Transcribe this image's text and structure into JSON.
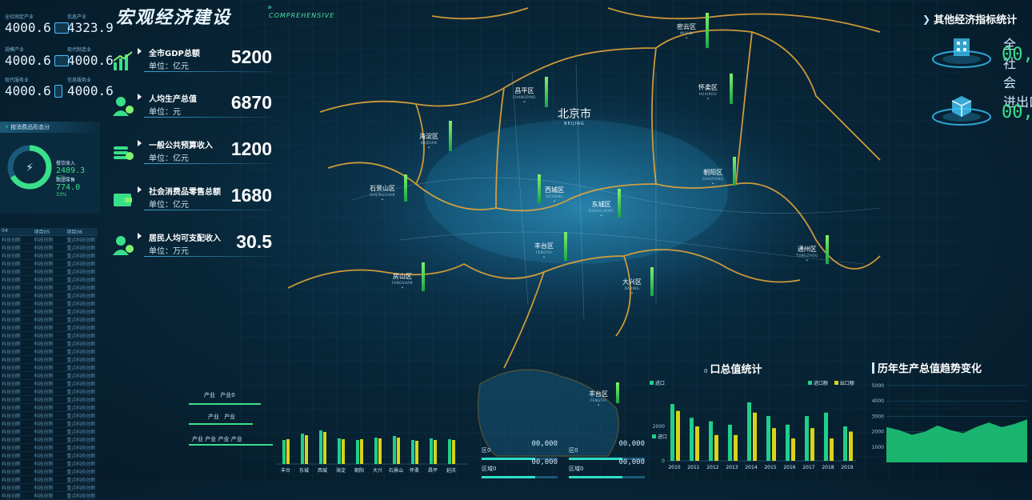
{
  "header": {
    "title": "宏观经济建设",
    "subtitle": "COMPREHENSIVE"
  },
  "top_tiles": [
    {
      "label": "全社固定产业",
      "value": "4000.6",
      "icon": "building-icon"
    },
    {
      "label": "信息产业",
      "value": "4323.9",
      "icon": "truck-icon"
    },
    {
      "label": "规模产业",
      "value": "4000.6",
      "icon": "car-icon"
    },
    {
      "label": "现代制造业",
      "value": "4000.6",
      "icon": "car-icon"
    },
    {
      "label": "现代服务业",
      "value": "4000.6",
      "icon": "phone-icon"
    },
    {
      "label": "信息服务业",
      "value": "4000.6",
      "icon": "phone-icon"
    }
  ],
  "consumption": {
    "title": "按消费品形态分",
    "items": [
      {
        "label": "餐饮收入",
        "pct": "67%",
        "value": "2489.3"
      },
      {
        "label": "商品零售",
        "pct": "33%",
        "value": "774.0"
      }
    ],
    "share": 0.67
  },
  "left_table": {
    "headers": [
      "04",
      "项目05",
      "项目06"
    ],
    "rows": [
      [
        "科技创新",
        "科技创新",
        "重点科技创新"
      ],
      [
        "科技创新",
        "科技创新",
        "重点科技创新"
      ],
      [
        "科技创新",
        "科技创新",
        "重点科技创新"
      ],
      [
        "科技创新",
        "科技创新",
        "重点科技创新"
      ],
      [
        "科技创新",
        "科技创新",
        "重点科技创新"
      ],
      [
        "科技创新",
        "科技创新",
        "重点科技创新"
      ],
      [
        "科技创新",
        "科技创新",
        "重点科技创新"
      ],
      [
        "科技创新",
        "科技创新",
        "重点科技创新"
      ],
      [
        "科技创新",
        "科技创新",
        "重点科技创新"
      ],
      [
        "科技创新",
        "科技创新",
        "重点科技创新"
      ],
      [
        "科技创新",
        "科技创新",
        "重点科技创新"
      ],
      [
        "科技创新",
        "科技创新",
        "重点科技创新"
      ],
      [
        "科技创新",
        "科技创新",
        "重点科技创新"
      ],
      [
        "科技创新",
        "科技创新",
        "重点科技创新"
      ],
      [
        "科技创新",
        "科技创新",
        "重点科技创新"
      ],
      [
        "科技创新",
        "科技创新",
        "重点科技创新"
      ],
      [
        "科技创新",
        "科技创新",
        "重点科技创新"
      ],
      [
        "科技创新",
        "科技创新",
        "重点科技创新"
      ],
      [
        "科技创新",
        "科技创新",
        "重点科技创新"
      ],
      [
        "科技创新",
        "科技创新",
        "重点科技创新"
      ],
      [
        "科技创新",
        "科技创新",
        "重点科技创新"
      ],
      [
        "科技创新",
        "科技创新",
        "重点科技创新"
      ],
      [
        "科技创新",
        "科技创新",
        "重点科技创新"
      ],
      [
        "科技创新",
        "科技创新",
        "重点科技创新"
      ],
      [
        "科技创新",
        "科技创新",
        "重点科技创新"
      ],
      [
        "科技创新",
        "科技创新",
        "重点科技创新"
      ],
      [
        "科技创新",
        "科技创新",
        "重点科技创新"
      ],
      [
        "科技创新",
        "科技创新",
        "重点科技创新"
      ],
      [
        "科技创新",
        "科技创新",
        "重点科技创新"
      ],
      [
        "科技创新",
        "科技创新",
        "重点科技创新"
      ],
      [
        "科技创新",
        "科技创新",
        "重点科技创新"
      ],
      [
        "科技创新",
        "科技创新",
        "重点科技创新"
      ],
      [
        "科技创新",
        "科技创新",
        "重点科技创新"
      ]
    ]
  },
  "kpis": [
    {
      "name": "全市GDP总额",
      "unit": "单位：亿元",
      "value": "5200",
      "icon": "chart-up-icon"
    },
    {
      "name": "人均生产总值",
      "unit": "单位：元",
      "value": "6870",
      "icon": "user-money-icon"
    },
    {
      "name": "一般公共预算收入",
      "unit": "单位：亿元",
      "value": "1200",
      "icon": "coins-icon"
    },
    {
      "name": "社会消费品零售总额",
      "unit": "单位：亿元",
      "value": "1680",
      "icon": "wallet-icon"
    },
    {
      "name": "居民人均可支配收入",
      "unit": "单位：万元",
      "value": "30.5",
      "icon": "user-money-icon"
    }
  ],
  "map": {
    "city": {
      "name": "北京市",
      "en": "BEIJING"
    },
    "districts": [
      {
        "name": "密云区",
        "en": "MIYUN"
      },
      {
        "name": "怀柔区",
        "en": "HUAIROU"
      },
      {
        "name": "昌平区",
        "en": "CHANGPING"
      },
      {
        "name": "海淀区",
        "en": "HAIDIAN"
      },
      {
        "name": "朝阳区",
        "en": "CHAOYANG"
      },
      {
        "name": "石景山区",
        "en": "SHIJINGSHAN"
      },
      {
        "name": "西城区",
        "en": "XICHENG"
      },
      {
        "name": "东城区",
        "en": "DONGCHENG"
      },
      {
        "name": "丰台区",
        "en": "FENGTAI"
      },
      {
        "name": "通州区",
        "en": "TONGZHOU"
      },
      {
        "name": "房山区",
        "en": "FANGSHAN"
      },
      {
        "name": "大兴区",
        "en": "DAXING"
      },
      {
        "name": "丰台区",
        "en": "FENGTAI"
      }
    ]
  },
  "right_panel": {
    "title": "其他经济指标统计",
    "items": [
      {
        "label": "全社会",
        "value": "00,"
      },
      {
        "label": "进出口额",
        "value": "00,"
      }
    ]
  },
  "industry_legend": [
    [
      "产业",
      "产业0"
    ],
    [
      "产业",
      "产业"
    ],
    [
      "产业",
      "产业",
      "产业",
      "产业"
    ]
  ],
  "district_chart": {
    "categories": [
      "丰台",
      "东城",
      "西城",
      "海淀",
      "朝阳",
      "大兴",
      "石景山",
      "怀柔",
      "昌平",
      "延庆"
    ],
    "values": [
      30,
      38,
      42,
      32,
      30,
      33,
      35,
      30,
      32,
      31
    ],
    "values2": [
      31,
      36,
      40,
      31,
      31,
      32,
      33,
      29,
      30,
      30
    ],
    "ylim": [
      0,
      50
    ]
  },
  "district_stats": [
    {
      "label": "区0",
      "value": "00,000"
    },
    {
      "label": "区0",
      "value": "00,000"
    },
    {
      "label": "区域0",
      "value": "00,000"
    },
    {
      "label": "区域0",
      "value": "00,000"
    }
  ],
  "chart_data": [
    {
      "type": "bar",
      "title": "口总值统计",
      "title_prefix": "0",
      "categories": [
        "2010",
        "2011",
        "2012",
        "2013",
        "2014",
        "2015",
        "2016",
        "2017",
        "2018",
        "2019"
      ],
      "series": [
        {
          "name": "进口额",
          "values": [
            3300,
            2500,
            2300,
            2100,
            3400,
            2600,
            2100,
            2600,
            2800,
            2000
          ]
        },
        {
          "name": "出口额",
          "values": [
            2900,
            2000,
            1500,
            1500,
            2800,
            1900,
            1300,
            1900,
            1300,
            1700
          ]
        }
      ],
      "legend_small": "进口",
      "ylim": [
        0,
        4000
      ],
      "yticks": [
        0,
        2000,
        4000
      ],
      "ytick_labels_shown": [
        "2000",
        "0"
      ],
      "colors": [
        "#1fd08a",
        "#d9d21a"
      ]
    },
    {
      "type": "area",
      "title": "历年生产总值趋势变化",
      "yticks": [
        1000,
        2000,
        3000,
        4000,
        5000
      ],
      "x": [
        0,
        1,
        2,
        3,
        4,
        5,
        6,
        7,
        8,
        9,
        10,
        11
      ],
      "values": [
        2300,
        2100,
        1800,
        2000,
        2400,
        2100,
        1900,
        2300,
        2600,
        2300,
        2500,
        2800
      ],
      "ylim": [
        0,
        5000
      ],
      "color": "#1fcf7a"
    }
  ]
}
